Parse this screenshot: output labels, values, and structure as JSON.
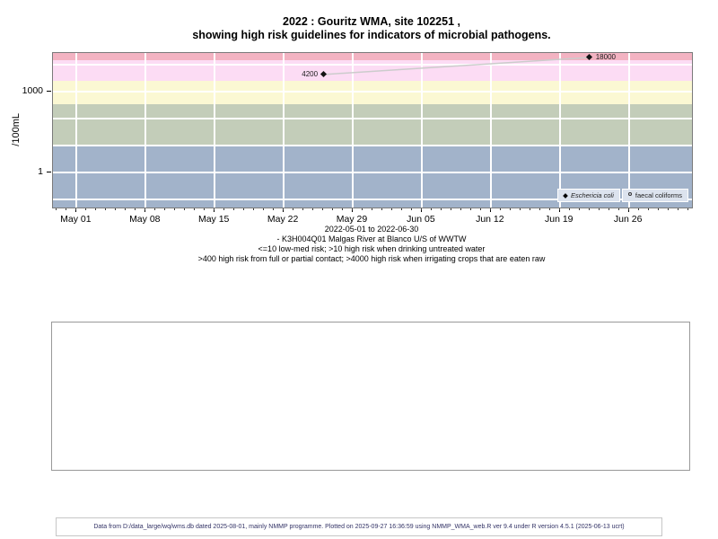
{
  "title": {
    "line1": "2022 : Gouritz WMA, site 102251 ,",
    "line2": "showing high risk guidelines for indicators of microbial pathogens."
  },
  "subtitle": {
    "line1": "2022-05-01 to 2022-06-30",
    "line2": "- K3H004Q01 Malgas River at Blanco U/S of WWTW",
    "line3": "<=10 low-med risk; >10 high risk when drinking untreated water",
    "line4": ">400 high risk from full or partial contact; >4000 high risk when irrigating crops that are eaten raw"
  },
  "footer": {
    "text": "Data from D:/data_large/wq/wms.db dated 2025-08-01, mainly NMMP programme. Plotted on 2025-09-27 16:36:59 using NMMP_WMA_web.R ver 9.4 under R version 4.5.1 (2025-06-13 ucrt)"
  },
  "chart_data": {
    "type": "scatter",
    "title": "2022 : Gouritz WMA, site 102251 , showing high risk guidelines for indicators of microbial pathogens.",
    "ylabel": "/100mL",
    "y_scale": "log10",
    "ylim_log10": [
      -1.3,
      4.42
    ],
    "xlim_dates": [
      "2022-05-01",
      "2022-06-30"
    ],
    "x_range_days": [
      -2.4,
      62.4
    ],
    "x_minor_ticks": "daily",
    "gridline_color": "#ffffff",
    "h_gridlines_log10": [
      -1,
      0,
      1,
      2,
      3,
      4
    ],
    "x_ticks": [
      {
        "day": 0,
        "label": "May 01"
      },
      {
        "day": 7,
        "label": "May 08"
      },
      {
        "day": 14,
        "label": "May 15"
      },
      {
        "day": 21,
        "label": "May 22"
      },
      {
        "day": 28,
        "label": "May 29"
      },
      {
        "day": 35,
        "label": "Jun 05"
      },
      {
        "day": 42,
        "label": "Jun 12"
      },
      {
        "day": 49,
        "label": "Jun 19"
      },
      {
        "day": 56,
        "label": "Jun 26"
      }
    ],
    "y_ticks": [
      {
        "log10": 3,
        "label": "1000"
      },
      {
        "log10": 0,
        "label": "1"
      }
    ],
    "risk_bands": [
      {
        "name": "pink-dark-top",
        "color": "#f3b3c2",
        "from_log10": 4.144,
        "to_log10": 4.42
      },
      {
        "name": "pink-light",
        "color": "#fcdcf4",
        "from_log10": 3.389,
        "to_log10": 4.144
      },
      {
        "name": "yellow",
        "color": "#fbf8d3",
        "from_log10": 2.535,
        "to_log10": 3.389
      },
      {
        "name": "green",
        "color": "#c3cdb9",
        "from_log10": 1.0,
        "to_log10": 2.535
      },
      {
        "name": "blue-low-risk",
        "color": "#a2b3ca",
        "from_log10": -1.3,
        "to_log10": 1.0
      }
    ],
    "series": [
      {
        "name": "Eschericia coli",
        "symbol": "filled-diamond",
        "color": "#141414",
        "connect_color": "#cccccc",
        "points": [
          {
            "day": 25,
            "value": 4200,
            "label": "4200",
            "label_side": "left"
          },
          {
            "day": 52,
            "value": 18000,
            "label": "18000",
            "label_side": "right"
          }
        ]
      },
      {
        "name": "faecal coliforms",
        "symbol": "open-circle",
        "color": "#333333",
        "points": []
      }
    ],
    "legend": {
      "position": "bottom-right",
      "bg": "#dce3ee",
      "items": [
        {
          "label": "Eschericia coli",
          "symbol": "filled-diamond",
          "italic": true
        },
        {
          "label": "faecal coliforms",
          "symbol": "open-circle",
          "italic": false
        }
      ]
    }
  }
}
